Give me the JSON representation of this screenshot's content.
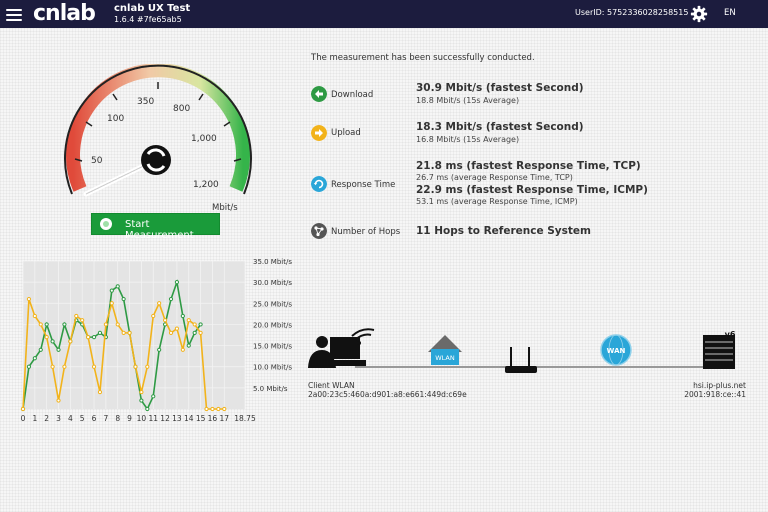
{
  "header": {
    "logo": "cnlab",
    "app_name": "cnlab UX Test",
    "version": "1.6.4 #7fe65ab5",
    "user_id": "UserID: 5752336028258515",
    "language": "EN"
  },
  "gauge": {
    "ticks": [
      "50",
      "100",
      "350",
      "800",
      "1,000",
      "1,200"
    ],
    "unit": "Mbit/s"
  },
  "start_button": "Start Measurement",
  "result_message": "The measurement has been successfully conducted.",
  "results": {
    "download": {
      "label": "Download",
      "fastest": "30.9 Mbit/s (fastest Second)",
      "average": "18.8 Mbit/s (15s Average)",
      "icon": "download-arrow-icon",
      "color": "#2e9a44"
    },
    "upload": {
      "label": "Upload",
      "fastest": "18.3 Mbit/s (fastest Second)",
      "average": "16.8 Mbit/s (15s Average)",
      "icon": "upload-arrow-icon",
      "color": "#f2b31b"
    },
    "response_time": {
      "label": "Response Time",
      "tcp_fastest": "21.8 ms (fastest Response Time, TCP)",
      "tcp_avg": "26.7 ms (average Response Time, TCP)",
      "icmp_fastest": "22.9 ms (fastest Response Time, ICMP)",
      "icmp_avg": "53.1 ms (average Response Time, ICMP)",
      "icon": "refresh-icon",
      "color": "#2aa6d8"
    },
    "hops": {
      "label": "Number of Hops",
      "value": "11 Hops to Reference System",
      "icon": "network-hops-icon",
      "color": "#555555"
    }
  },
  "chart_data": {
    "type": "line",
    "x_ticks": [
      "0",
      "1",
      "2",
      "3",
      "4",
      "5",
      "6",
      "7",
      "8",
      "9",
      "10",
      "11",
      "12",
      "13",
      "14",
      "15",
      "16",
      "17",
      "18.75"
    ],
    "y_ticks": [
      "35.0 Mbit/s",
      "30.0 Mbit/s",
      "25.0 Mbit/s",
      "20.0 Mbit/s",
      "15.0 Mbit/s",
      "10.0 Mbit/s",
      "5.0 Mbit/s"
    ],
    "ylim": [
      0,
      35
    ],
    "xlim": [
      0,
      18.75
    ],
    "series": [
      {
        "color": "#2e9a44",
        "x": [
          0,
          0.5,
          1,
          1.5,
          2,
          2.5,
          3,
          3.5,
          4,
          4.5,
          5,
          5.5,
          6,
          6.5,
          7,
          7.5,
          8,
          8.5,
          9,
          9.5,
          10,
          10.5,
          11,
          11.5,
          12,
          12.5,
          13,
          13.5,
          14,
          14.5,
          15
        ],
        "values": [
          0,
          10,
          12,
          14,
          20,
          16,
          14,
          20,
          16,
          21,
          20,
          17,
          17,
          18,
          17,
          28,
          29,
          26,
          18,
          10,
          2,
          0,
          3,
          14,
          20,
          26,
          30,
          22,
          15,
          18,
          20
        ]
      },
      {
        "color": "#f2b31b",
        "x": [
          0,
          0.5,
          1,
          1.5,
          2,
          2.5,
          3,
          3.5,
          4,
          4.5,
          5,
          5.5,
          6,
          6.5,
          7,
          7.5,
          8,
          8.5,
          9,
          9.5,
          10,
          10.5,
          11,
          11.5,
          12,
          12.5,
          13,
          13.5,
          14,
          14.5,
          15,
          15.5,
          16,
          16.5,
          17
        ],
        "values": [
          0,
          26,
          22,
          20,
          17,
          10,
          2,
          10,
          16,
          22,
          21,
          17,
          10,
          4,
          20,
          25,
          20,
          18,
          18,
          10,
          4,
          10,
          22,
          25,
          21,
          18,
          19,
          14,
          21,
          20,
          18,
          0,
          0,
          0,
          0
        ]
      }
    ]
  },
  "network": {
    "client_label": "Client WLAN",
    "client_address": "2a00:23c5:460a:d901:a8:e661:449d:c69e",
    "wlan_badge": "WLAN",
    "wan_badge": "WAN",
    "v6_badge": "v6",
    "server_host": "hsi.ip-plus.net",
    "server_address": "2001:918:ce::41"
  },
  "colors": {
    "header_bg": "#1c1c3e",
    "accent_green": "#1a9b3a"
  }
}
